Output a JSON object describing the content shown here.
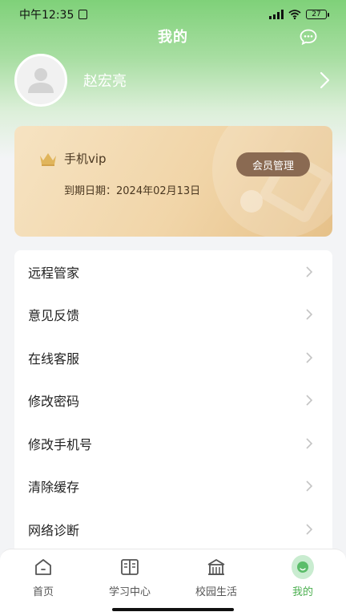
{
  "status_bar": {
    "time": "中午12:35",
    "signal": "5G",
    "battery": "27"
  },
  "header": {
    "title": "我的"
  },
  "profile": {
    "name": "赵宏亮"
  },
  "vip": {
    "title": "手机vip",
    "expiry": "到期日期：2024年02月13日",
    "manage_button": "会员管理"
  },
  "menu": {
    "items": [
      {
        "label": "远程管家"
      },
      {
        "label": "意见反馈"
      },
      {
        "label": "在线客服"
      },
      {
        "label": "修改密码"
      },
      {
        "label": "修改手机号"
      },
      {
        "label": "清除缓存"
      },
      {
        "label": "网络诊断"
      }
    ]
  },
  "tabbar": {
    "tabs": [
      {
        "label": "首页",
        "icon": "home-icon"
      },
      {
        "label": "学习中心",
        "icon": "book-icon"
      },
      {
        "label": "校园生活",
        "icon": "building-icon"
      },
      {
        "label": "我的",
        "icon": "profile-icon",
        "active": true
      }
    ]
  },
  "colors": {
    "header_green": "#7fd179",
    "accent_green": "#4caf50",
    "vip_button": "#8a6a52"
  }
}
